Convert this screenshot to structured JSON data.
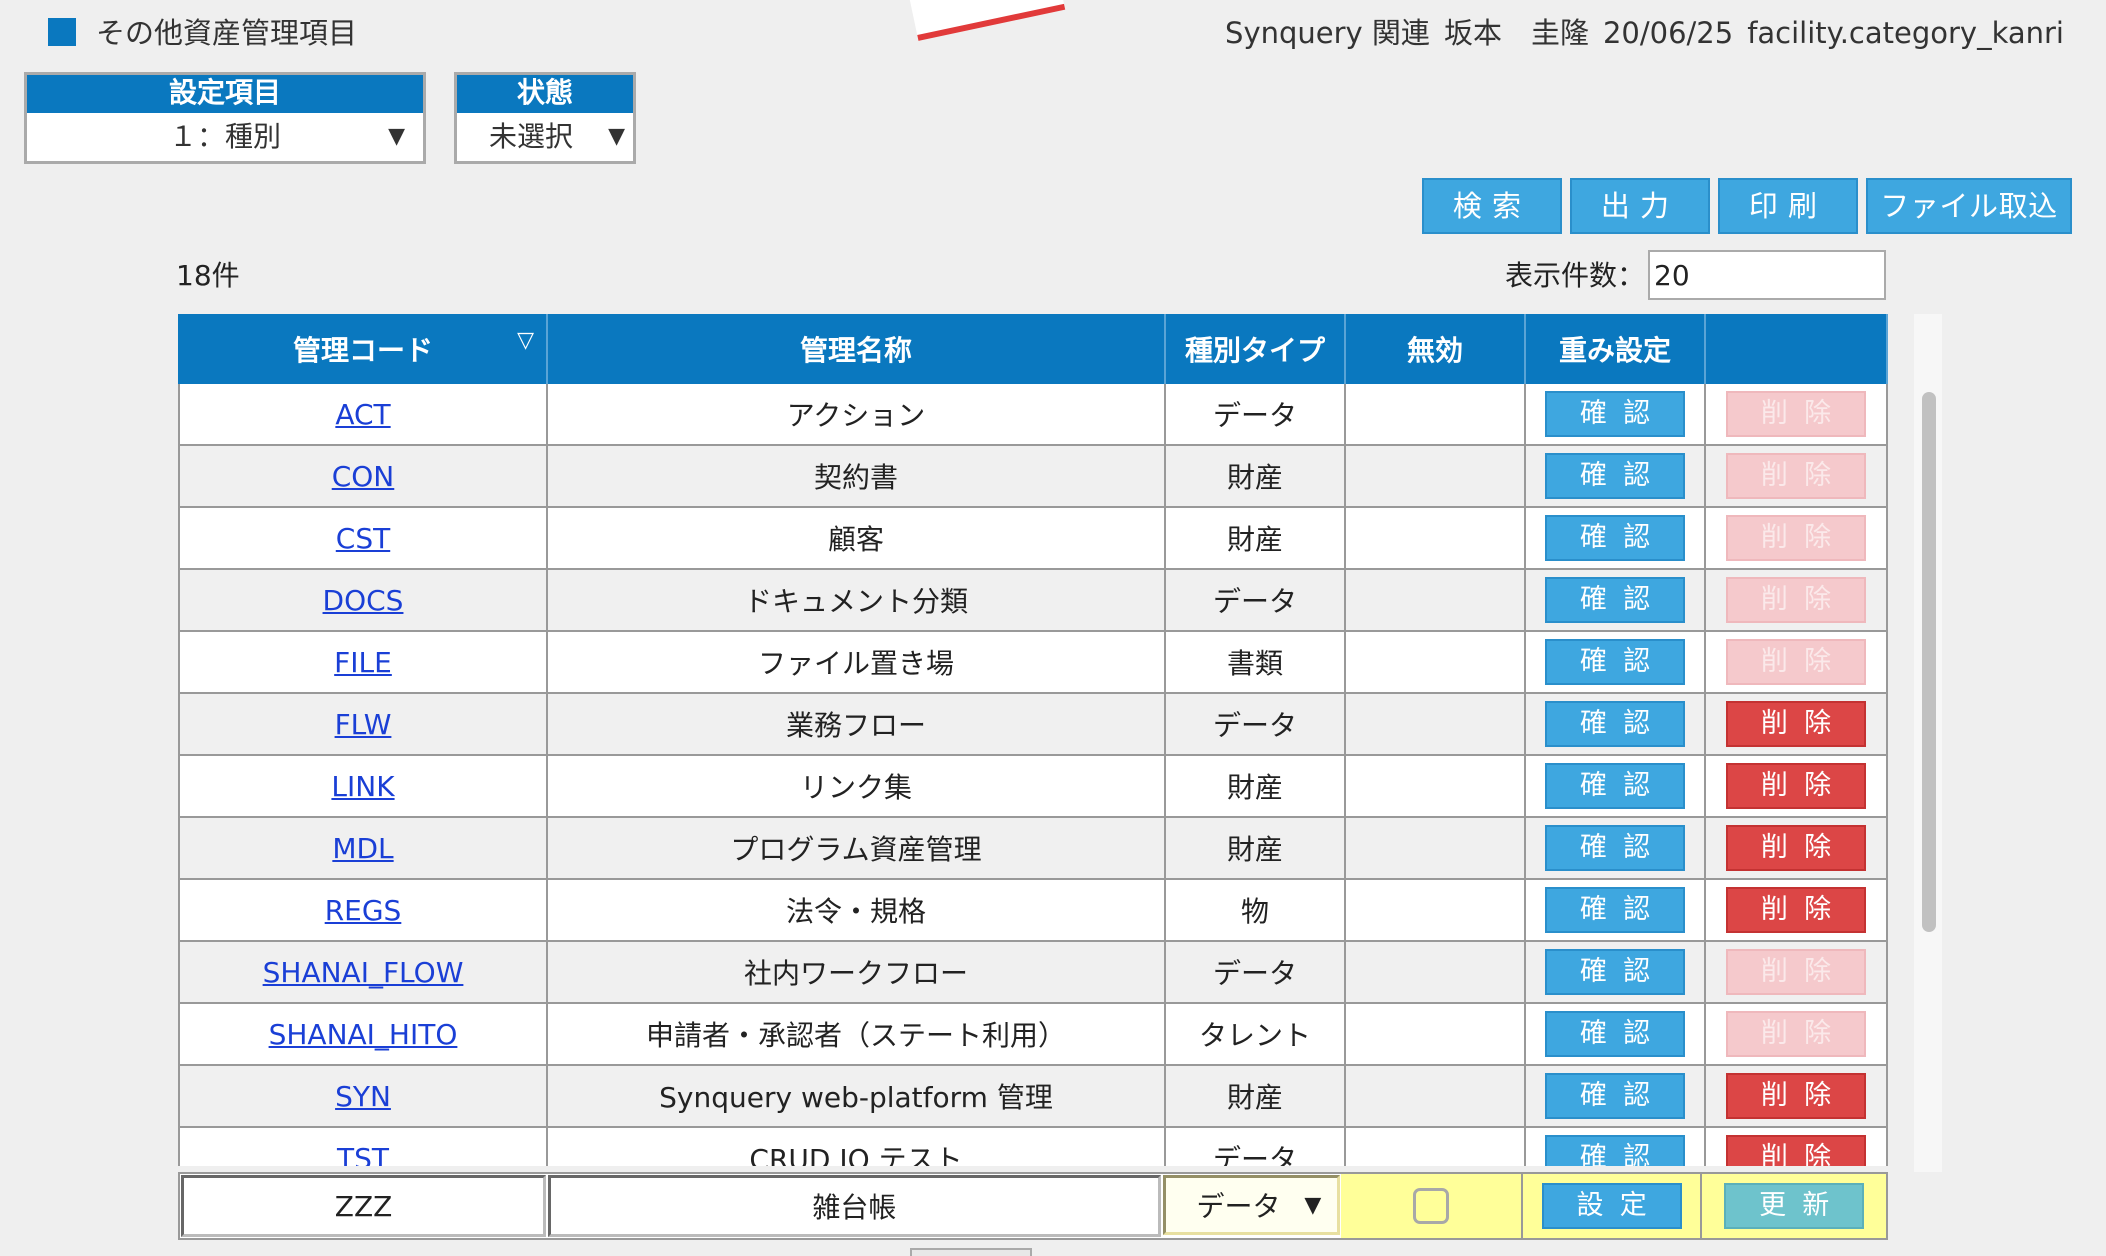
{
  "header": {
    "title": "その他資産管理項目",
    "user_dept": "Synquery 関連",
    "user_name": "坂本　圭隆",
    "date": "20/06/25",
    "screen_id": "facility.category_kanri"
  },
  "filters": {
    "setting": {
      "label": "設定項目",
      "value": "１：種別"
    },
    "status": {
      "label": "状態",
      "value": "未選択"
    }
  },
  "toolbar": {
    "search": "検索",
    "export": "出力",
    "print": "印刷",
    "import": "ファイル取込"
  },
  "list": {
    "count_text": "18件",
    "per_page_label": "表示件数：",
    "per_page_value": "20"
  },
  "table": {
    "columns": [
      "管理コード",
      "管理名称",
      "種別タイプ",
      "無効",
      "重み設定",
      ""
    ],
    "confirm_label": "確認",
    "delete_label": "削除",
    "rows": [
      {
        "code": "ACT",
        "name": "アクション",
        "type": "データ",
        "delete_enabled": false
      },
      {
        "code": "CON",
        "name": "契約書",
        "type": "財産",
        "delete_enabled": false
      },
      {
        "code": "CST",
        "name": "顧客",
        "type": "財産",
        "delete_enabled": false
      },
      {
        "code": "DOCS",
        "name": "ドキュメント分類",
        "type": "データ",
        "delete_enabled": false
      },
      {
        "code": "FILE",
        "name": "ファイル置き場",
        "type": "書類",
        "delete_enabled": false
      },
      {
        "code": "FLW",
        "name": "業務フロー",
        "type": "データ",
        "delete_enabled": true
      },
      {
        "code": "LINK",
        "name": "リンク集",
        "type": "財産",
        "delete_enabled": true
      },
      {
        "code": "MDL",
        "name": "プログラム資産管理",
        "type": "財産",
        "delete_enabled": true
      },
      {
        "code": "REGS",
        "name": "法令・規格",
        "type": "物",
        "delete_enabled": true
      },
      {
        "code": "SHANAI_FLOW",
        "name": "社内ワークフロー",
        "type": "データ",
        "delete_enabled": false
      },
      {
        "code": "SHANAI_HITO",
        "name": "申請者・承認者（ステート利用）",
        "type": "タレント",
        "delete_enabled": false
      },
      {
        "code": "SYN",
        "name": "Synquery web-platform 管理",
        "type": "財産",
        "delete_enabled": true
      },
      {
        "code": "TST",
        "name": "CRUD IO テスト",
        "type": "データ",
        "delete_enabled": true
      }
    ]
  },
  "new_entry": {
    "code": "ZZZ",
    "name": "雑台帳",
    "type": "データ",
    "set_label": "設定",
    "update_label": "更新"
  },
  "colors": {
    "primary": "#0a78bf",
    "button": "#3ea7e0",
    "delete_active": "#dc4646",
    "delete_disabled": "#f5c9cc",
    "edit_row": "#ffff99"
  }
}
